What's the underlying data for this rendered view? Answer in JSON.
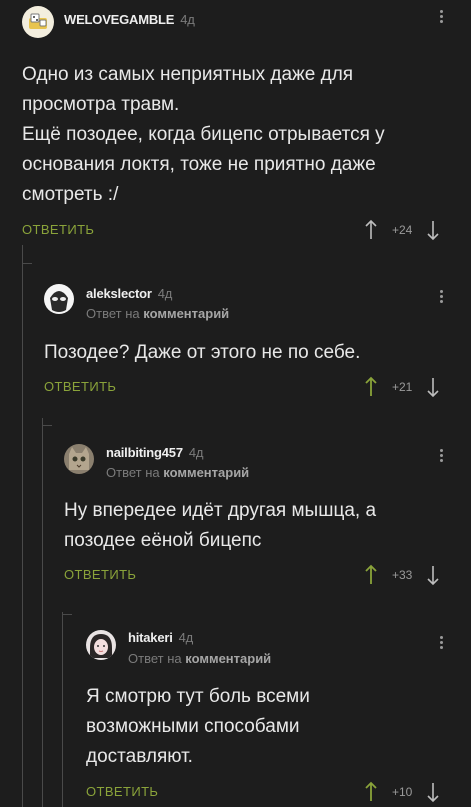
{
  "ui": {
    "reply_label": "ОТВЕТИТЬ",
    "reply_prefix": "Ответ на",
    "reply_target": "комментарий"
  },
  "comments": [
    {
      "author": "WELOVEGAMBLE",
      "time": "4д",
      "lines": [
        "Одно из самых неприятных даже для",
        "просмотра травм.",
        "Ещё позодее, когда бицепс отрывается у",
        "основания локтя, тоже не приятно даже",
        "смотреть :/"
      ],
      "score": "+24",
      "upvoted": false
    },
    {
      "author": "alekslector",
      "time": "4д",
      "lines": [
        "Позодее? Даже от этого не по себе."
      ],
      "score": "+21",
      "upvoted": true
    },
    {
      "author": "nailbiting457",
      "time": "4д",
      "lines": [
        "Ну впередее идёт другая мышца, а",
        "позодее еёной бицепс"
      ],
      "score": "+33",
      "upvoted": true
    },
    {
      "author": "hitakeri",
      "time": "4д",
      "lines": [
        "Я смотрю тут боль всеми",
        "возможными способами",
        "доставляют."
      ],
      "score": "+10",
      "upvoted": true
    }
  ],
  "colors": {
    "accent": "#8aa33a",
    "background": "#1d1d1d",
    "muted": "#7b7b7b"
  },
  "icons": [
    "up-arrow-icon",
    "down-arrow-icon",
    "kebab-menu-icon"
  ]
}
